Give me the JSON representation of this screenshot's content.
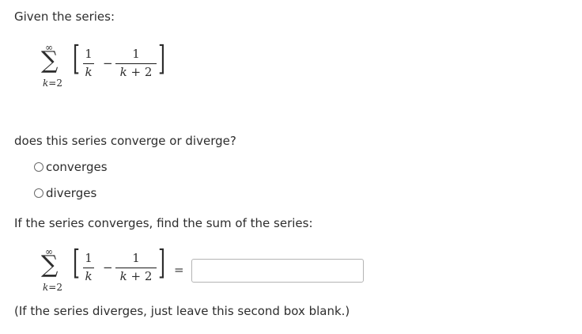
{
  "intro": "Given the series:",
  "series": {
    "sum_symbol": "∑",
    "upper_limit": "∞",
    "lower_limit_var": "k",
    "lower_limit_eq": "=2",
    "bracket_left": "[",
    "bracket_right": "]",
    "term1_num": "1",
    "term1_den": "k",
    "minus": "−",
    "term2_num": "1",
    "term2_den_var": "k",
    "term2_den_rest": " + 2",
    "equals": "="
  },
  "question": "does this series converge or diverge?",
  "options": [
    {
      "label": "converges",
      "selected": false
    },
    {
      "label": "diverges",
      "selected": false
    }
  ],
  "sum_prompt": "If the series converges, find the sum of the series:",
  "answer": {
    "value": "",
    "placeholder": ""
  },
  "footnote": "(If the series diverges, just leave this second box blank.)"
}
